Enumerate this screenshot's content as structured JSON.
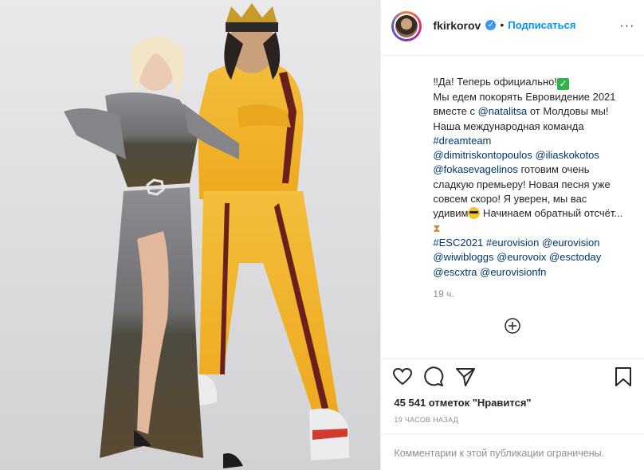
{
  "post": {
    "author": {
      "username": "fkirkorov",
      "verified": true,
      "follow_label": "Подписаться",
      "more_label": "···"
    },
    "caption": {
      "line1": "‼Да! Теперь официально!",
      "line2": "Мы едем покорять Евровидение 2021 вместе с ",
      "mention1": "@natalitsa",
      "line3": " от Молдовы мы! Наша международная команда ",
      "hashtag1": "#dreamteam",
      "mentions_team": "@dimitriskontopoulos @iliaskokotos @fokasevagelinos",
      "line4": " готовим очень сладкую премьеру! Новая песня уже совсем скоро! Я уверен, мы вас удивим",
      "line5": " Начинаем обратный отсчёт...",
      "tags_end": "#ESC2021 #eurovision @eurovision @wiwibloggs @eurovoix @esctoday @escxtra @eurovisionfn"
    },
    "time_ago": "19 ч.",
    "likes_text": "45 541 отметок \"Нравится\"",
    "posted_ago": "19 ЧАСОВ НАЗАД",
    "comments_restricted": "Комментарии к этой публикации ограничены."
  },
  "icons": {
    "like": "heart-icon",
    "comment": "comment-icon",
    "share": "paper-plane-icon",
    "save": "bookmark-icon",
    "add": "plus-circle-icon",
    "verified": "verified-badge-icon"
  },
  "colors": {
    "link": "#0095f6",
    "hashtag": "#00376b",
    "muted": "#8e8e8e",
    "text": "#262626",
    "verified": "#3897f0",
    "tracksuit": "#f2b531"
  }
}
